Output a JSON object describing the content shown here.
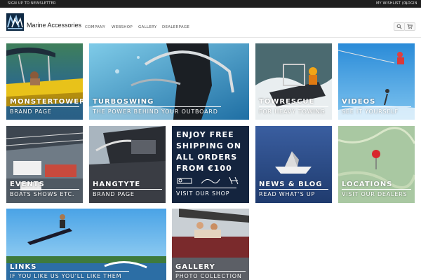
{
  "topbar": {
    "newsletter": "SIGN UP TO NEWSLETTER",
    "wishlist": "MY WISHLIST (0)",
    "login": "LOGIN"
  },
  "header": {
    "brand": "Marine Accessories",
    "nav": [
      "COMPANY",
      "WEBSHOP",
      "GALLERY",
      "DEALERPAGE"
    ],
    "icons": [
      "search-icon",
      "cart-icon"
    ]
  },
  "tiles": [
    {
      "title": "MONSTERTOWER",
      "subtitle": "BRAND PAGE"
    },
    {
      "title": "TURBOSWING",
      "subtitle": "THE POWER BEHIND YOUR OUTBOARD"
    },
    {
      "title": "TOWRESCUE",
      "subtitle": "FOR HEAVY TOWING"
    },
    {
      "title": "VIDEOS",
      "subtitle": "SEE IT YOURSELF"
    },
    {
      "title": "EVENTS",
      "subtitle": "BOATS SHOWS ETC."
    },
    {
      "title": "HANGTYTE",
      "subtitle": "BRAND PAGE"
    },
    {
      "title": "NEWS & BLOG",
      "subtitle": "READ WHAT'S UP"
    },
    {
      "title": "LOCATIONS",
      "subtitle": "VISIT OUR DEALERS"
    },
    {
      "title": "LINKS",
      "subtitle": "IF YOU LIKE US YOU'LL LIKE THEM"
    },
    {
      "title": "GALLERY",
      "subtitle": "PHOTO COLLECTION"
    }
  ],
  "promo": {
    "lines": [
      "ENJOY FREE",
      "SHIPPING ON",
      "ALL ORDERS",
      "FROM €100"
    ],
    "cta": "VISIT OUR SHOP"
  }
}
